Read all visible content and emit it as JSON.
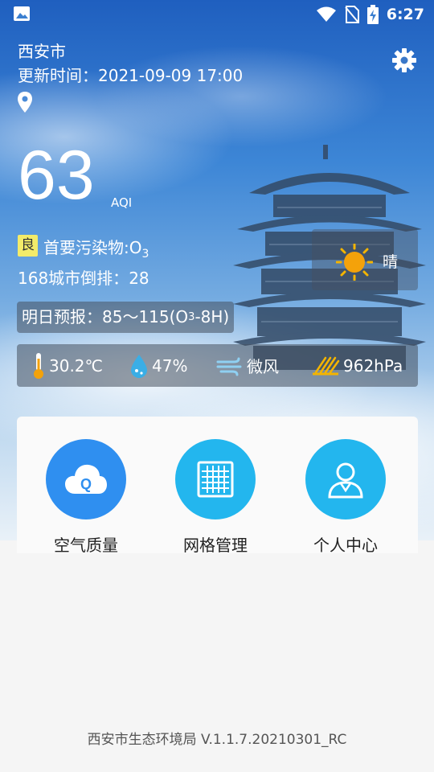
{
  "status_bar": {
    "time": "6:27"
  },
  "header": {
    "city": "西安市",
    "update_label": "更新时间：",
    "update_time": "2021-09-09 17:00"
  },
  "aqi": {
    "value": "63",
    "unit": "AQI",
    "level": "良",
    "pollutant_label": "首要污染物:O",
    "pollutant_sub": "3",
    "rank_label": "168城市倒排：",
    "rank_value": "28"
  },
  "weather": {
    "condition": "晴"
  },
  "forecast": {
    "label": "明日预报：",
    "range": "85～115(O",
    "sub": "3",
    "suffix": "-8H)"
  },
  "stats": {
    "temperature": "30.2℃",
    "humidity": "47%",
    "wind": "微风",
    "pressure": "962hPa"
  },
  "features": [
    {
      "label": "空气质量",
      "color": "#2f8ff0"
    },
    {
      "label": "网格管理",
      "color": "#23b6ee"
    },
    {
      "label": "个人中心",
      "color": "#23b6ee"
    }
  ],
  "footer": {
    "text": "西安市生态环境局 V.1.1.7.20210301_RC"
  }
}
